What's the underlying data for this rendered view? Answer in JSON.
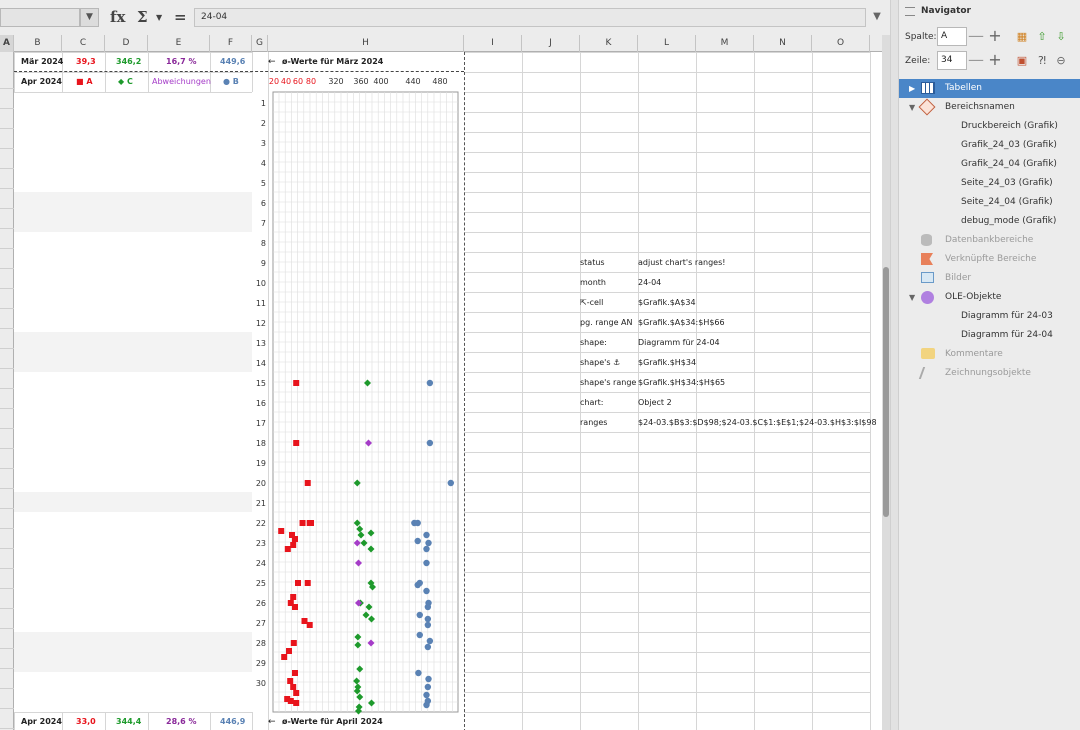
{
  "formula_bar": {
    "name_box": "",
    "function_wizard_icon": "fx",
    "sum_icon": "Σ",
    "formula_icon": "=",
    "formula": "24-04"
  },
  "columns": [
    "A",
    "B",
    "C",
    "D",
    "E",
    "F",
    "G",
    "H",
    "I",
    "J",
    "K",
    "L",
    "M",
    "N",
    "O"
  ],
  "summary_top": {
    "month": "Mär 2024",
    "c": "39,3",
    "d": "346,2",
    "e": "16,7 %",
    "f": "449,6",
    "note_arrow": "←",
    "note": "ø-Werte für März 2024"
  },
  "legend_row": {
    "month": "Apr 2024",
    "series_a": "■ A",
    "series_c": "◆ C",
    "series_dev": "Abweichungen",
    "series_b": "● B"
  },
  "summary_bottom": {
    "month": "Apr 2024",
    "c": "33,0",
    "d": "344,4",
    "e": "28,6 %",
    "f": "446,9",
    "note_arrow": "←",
    "note": "ø-Werte für April 2024"
  },
  "axis_ticks": [
    "20",
    "40",
    "60",
    "80",
    "320",
    "360",
    "400",
    "440",
    "480"
  ],
  "days": [
    "1",
    "2",
    "3",
    "4",
    "5",
    "6",
    "7",
    "8",
    "9",
    "10",
    "11",
    "12",
    "13",
    "14",
    "15",
    "16",
    "17",
    "18",
    "19",
    "20",
    "21",
    "22",
    "23",
    "24",
    "25",
    "26",
    "27",
    "28",
    "29",
    "30"
  ],
  "info_table": [
    {
      "key": "status",
      "value": "adjust chart's ranges!"
    },
    {
      "key": "month",
      "value": "24-04"
    },
    {
      "key": "⇱-cell",
      "value": "$Grafik.$A$34"
    },
    {
      "key": "pg. range AN",
      "value": "$Grafik.$A$34:$H$66"
    },
    {
      "key": "shape:",
      "value": "Diagramm für 24-04"
    },
    {
      "key": "shape's ⚓",
      "value": "$Grafik.$H$34"
    },
    {
      "key": "shape's range",
      "value": "$Grafik.$H$34:$H$65"
    },
    {
      "key": "chart:",
      "value": "Object 2"
    },
    {
      "key": "ranges",
      "value": "$24-03.$B$3:$D$98;$24-03.$C$1:$E$1;$24-03.$H$3:$I$98"
    }
  ],
  "colors": {
    "series_a": "#e8141c",
    "series_c": "#1e9a2c",
    "series_dev": "#a53cc8",
    "series_b": "#5a82b4",
    "selection": "#4a86c8"
  },
  "chart_data": {
    "type": "scatter",
    "orientation": "horizontal values, one row per day",
    "x_ticks": [
      "20",
      "40",
      "60",
      "80",
      "320",
      "360",
      "400",
      "440",
      "480"
    ],
    "y_categories": [
      "1",
      "2",
      "3",
      "4",
      "5",
      "6",
      "7",
      "8",
      "9",
      "10",
      "11",
      "12",
      "13",
      "14",
      "15",
      "16",
      "17",
      "18",
      "19",
      "20",
      "21",
      "22",
      "23",
      "24",
      "25",
      "26",
      "27",
      "28",
      "29",
      "30"
    ],
    "grid": true,
    "series": [
      {
        "name": "A",
        "marker": "square",
        "points": [
          [
            15,
            57
          ],
          [
            18,
            57
          ],
          [
            20,
            75
          ],
          [
            22,
            67
          ],
          [
            22,
            78
          ],
          [
            22,
            80
          ],
          [
            22.4,
            32
          ],
          [
            22.6,
            50
          ],
          [
            22.8,
            55
          ],
          [
            23.1,
            52
          ],
          [
            23.3,
            43
          ],
          [
            25,
            60
          ],
          [
            25,
            75
          ],
          [
            25.7,
            52
          ],
          [
            26,
            48
          ],
          [
            26.2,
            55
          ],
          [
            26.9,
            70
          ],
          [
            27.1,
            78
          ],
          [
            28,
            53
          ],
          [
            28.4,
            45
          ],
          [
            28.7,
            37
          ],
          [
            29.5,
            55
          ],
          [
            29.9,
            47
          ],
          [
            30.2,
            52
          ],
          [
            30.5,
            57
          ],
          [
            30.8,
            42
          ],
          [
            30.9,
            48
          ],
          [
            31,
            57
          ]
        ]
      },
      {
        "name": "C",
        "marker": "diamond",
        "points": [
          [
            15,
            373
          ],
          [
            20,
            354
          ],
          [
            22,
            354
          ],
          [
            22.3,
            358
          ],
          [
            22.5,
            380
          ],
          [
            22.6,
            360
          ],
          [
            23,
            366
          ],
          [
            23.3,
            380
          ],
          [
            25,
            380
          ],
          [
            25.2,
            383
          ],
          [
            26,
            359
          ],
          [
            26.2,
            376
          ],
          [
            26.6,
            370
          ],
          [
            26.8,
            381
          ],
          [
            27.7,
            355
          ],
          [
            28.1,
            355
          ],
          [
            29.3,
            358
          ],
          [
            29.9,
            353
          ],
          [
            30.2,
            355
          ],
          [
            30.4,
            354
          ],
          [
            30.7,
            358
          ],
          [
            31,
            381
          ],
          [
            31.2,
            357
          ],
          [
            31.4,
            356
          ]
        ]
      },
      {
        "name": "Abweichungen",
        "marker": "diamond",
        "points": [
          [
            18,
            375
          ],
          [
            23,
            354
          ],
          [
            24,
            356
          ],
          [
            26,
            356
          ],
          [
            28,
            380
          ]
        ]
      },
      {
        "name": "B",
        "marker": "circle",
        "points": [
          [
            15,
            465
          ],
          [
            18,
            465
          ],
          [
            20,
            496
          ],
          [
            22,
            442
          ],
          [
            22,
            447
          ],
          [
            22.6,
            460
          ],
          [
            22.9,
            447
          ],
          [
            23,
            463
          ],
          [
            23.3,
            460
          ],
          [
            24,
            460
          ],
          [
            25,
            450
          ],
          [
            25.1,
            447
          ],
          [
            25.4,
            460
          ],
          [
            26,
            463
          ],
          [
            26.2,
            462
          ],
          [
            26.6,
            450
          ],
          [
            26.8,
            462
          ],
          [
            27.1,
            462
          ],
          [
            27.6,
            450
          ],
          [
            27.9,
            465
          ],
          [
            28.2,
            462
          ],
          [
            29.5,
            448
          ],
          [
            29.8,
            463
          ],
          [
            30.2,
            462
          ],
          [
            30.6,
            460
          ],
          [
            30.9,
            462
          ],
          [
            31.1,
            460
          ]
        ]
      }
    ]
  },
  "navigator": {
    "title": "Navigator",
    "column_label": "Spalte:",
    "column_value": "A",
    "row_label": "Zeile:",
    "row_value": "34",
    "items": [
      {
        "label": "Tabellen",
        "state": "selected",
        "level": 0
      },
      {
        "label": "Bereichsnamen",
        "state": "expanded",
        "level": 0
      },
      {
        "label": "Druckbereich (Grafik)",
        "level": 1
      },
      {
        "label": "Grafik_24_03 (Grafik)",
        "level": 1
      },
      {
        "label": "Grafik_24_04 (Grafik)",
        "level": 1
      },
      {
        "label": "Seite_24_03 (Grafik)",
        "level": 1
      },
      {
        "label": "Seite_24_04 (Grafik)",
        "level": 1
      },
      {
        "label": "debug_mode (Grafik)",
        "level": 1
      },
      {
        "label": "Datenbankbereiche",
        "state": "empty",
        "level": 0
      },
      {
        "label": "Verknüpfte Bereiche",
        "state": "empty",
        "level": 0
      },
      {
        "label": "Bilder",
        "state": "empty",
        "level": 0
      },
      {
        "label": "OLE-Objekte",
        "state": "expanded",
        "level": 0
      },
      {
        "label": "Diagramm für 24-03",
        "level": 1
      },
      {
        "label": "Diagramm für 24-04",
        "level": 1
      },
      {
        "label": "Kommentare",
        "state": "empty",
        "level": 0
      },
      {
        "label": "Zeichnungsobjekte",
        "state": "empty",
        "level": 0
      }
    ]
  }
}
